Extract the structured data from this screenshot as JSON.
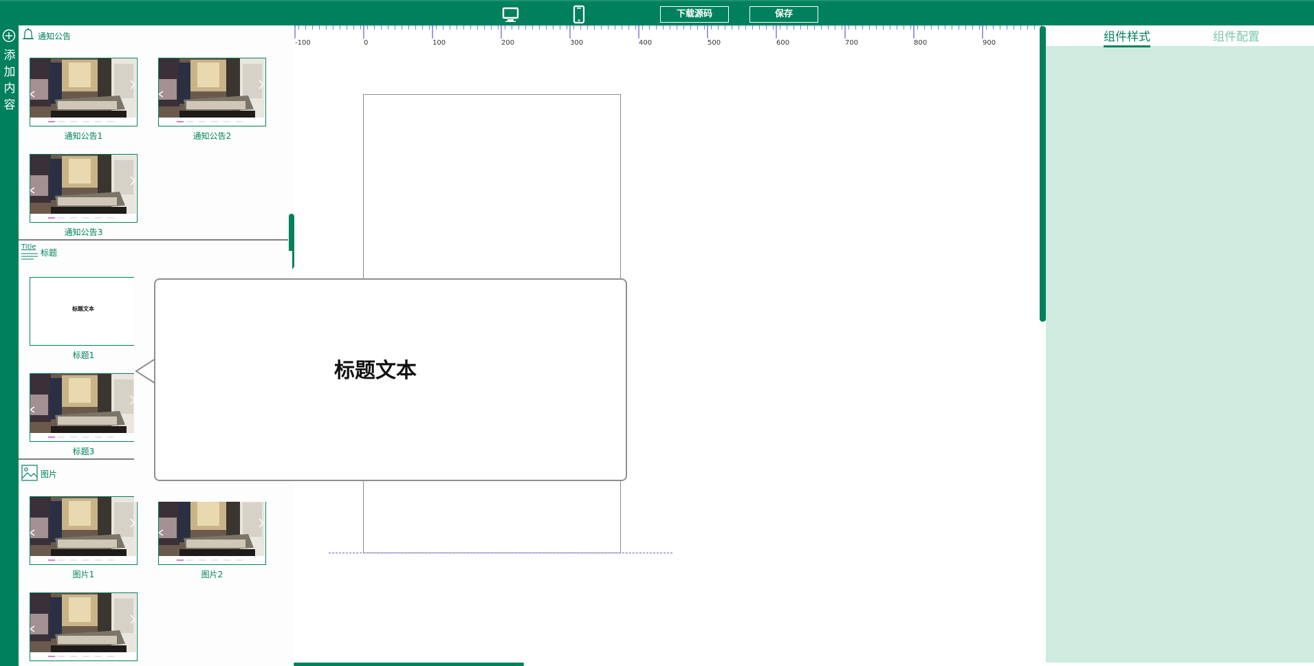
{
  "toolbar": {
    "desktop_icon": "desktop-icon",
    "mobile_icon": "mobile-phone-icon",
    "download_label": "下载源码",
    "save_label": "保存"
  },
  "sidebar": {
    "add_icon": "plus-circle-icon",
    "add_label_chars": [
      "添",
      "加",
      "内",
      "容"
    ]
  },
  "sections": {
    "notice": {
      "icon": "bell-icon",
      "title": "通知公告",
      "items": [
        "通知公告1",
        "通知公告2",
        "通知公告3"
      ]
    },
    "heading": {
      "icon": "title-lines-icon",
      "icon_text": "Title",
      "title": "标题",
      "items": [
        "标题1",
        "标题3"
      ],
      "thumb_text": "标题文本"
    },
    "image": {
      "icon": "image-icon",
      "title": "图片",
      "items": [
        "图片1",
        "图片2"
      ]
    }
  },
  "ruler": {
    "labels": [
      "-100",
      "0",
      "100",
      "200",
      "300",
      "400",
      "500",
      "600",
      "700",
      "800",
      "900"
    ]
  },
  "preview": {
    "text": "标题文本"
  },
  "right_panel": {
    "tabs": [
      {
        "label": "组件样式",
        "active": true
      },
      {
        "label": "组件配置",
        "active": false
      }
    ]
  },
  "colors": {
    "brand": "#00805c",
    "panel_bg": "#cfebe0",
    "active_indicator": "#d37be0"
  }
}
